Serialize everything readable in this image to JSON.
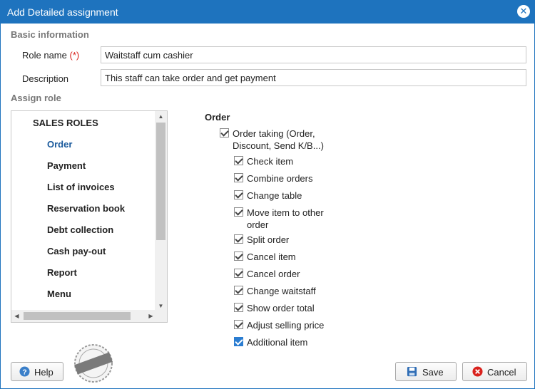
{
  "window": {
    "title": "Add Detailed assignment"
  },
  "basic_info": {
    "section_title": "Basic information",
    "role_name_label": "Role name",
    "required_marker": "(*)",
    "role_name_value": "Waitstaff cum cashier",
    "description_label": "Description",
    "description_value": "This staff can take order and get payment"
  },
  "assign_role": {
    "section_title": "Assign role",
    "roles": [
      {
        "label": "SALES ROLES",
        "kind": "header"
      },
      {
        "label": "Order",
        "kind": "item",
        "active": true
      },
      {
        "label": "Payment",
        "kind": "item"
      },
      {
        "label": "List of invoices",
        "kind": "item"
      },
      {
        "label": "Reservation book",
        "kind": "item"
      },
      {
        "label": "Debt collection",
        "kind": "item"
      },
      {
        "label": "Cash pay-out",
        "kind": "item"
      },
      {
        "label": "Report",
        "kind": "item"
      },
      {
        "label": "Menu",
        "kind": "item"
      }
    ]
  },
  "permissions": {
    "group_title": "Order",
    "parent": {
      "label_line1": "Order taking (Order,",
      "label_line2": "Discount, Send K/B...)",
      "checked": true
    },
    "items": [
      {
        "label": "Check item",
        "checked": true
      },
      {
        "label": "Combine orders",
        "checked": true
      },
      {
        "label": "Change table",
        "checked": true
      },
      {
        "label_line1": "Move item to other",
        "label_line2": "order",
        "checked": true
      },
      {
        "label": "Split order",
        "checked": true
      },
      {
        "label": "Cancel item",
        "checked": true
      },
      {
        "label": "Cancel order",
        "checked": true
      },
      {
        "label": "Change waitstaff",
        "checked": true
      },
      {
        "label": "Show order total",
        "checked": true
      },
      {
        "label": "Adjust selling price",
        "checked": true
      },
      {
        "label": "Additional item",
        "checked": true,
        "focused": true
      }
    ]
  },
  "stamp": {
    "text": "Sample Data"
  },
  "footer": {
    "help_label": "Help",
    "save_label": "Save",
    "cancel_label": "Cancel"
  },
  "colors": {
    "titlebar": "#1e73be",
    "active_role": "#1a5a9c",
    "required": "#d9211c",
    "focused_checkbox": "#2b7dd1"
  }
}
